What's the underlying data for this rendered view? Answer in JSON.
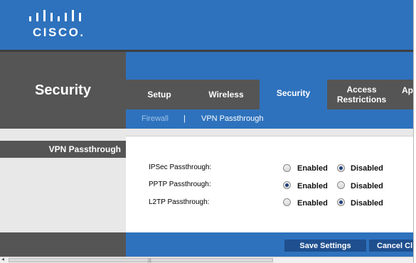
{
  "logo": {
    "text": "CISCO."
  },
  "header": {
    "page_title": "Security"
  },
  "tabs": [
    {
      "label": "Setup",
      "active": false
    },
    {
      "label": "Wireless",
      "active": false
    },
    {
      "label": "Security",
      "active": true
    },
    {
      "label": "Access\nRestrictions",
      "active": false
    },
    {
      "label": "Ap",
      "active": false
    }
  ],
  "subnav": {
    "firewall": "Firewall",
    "separator": "|",
    "vpn": "VPN Passthrough"
  },
  "section": {
    "label": "VPN Passthrough"
  },
  "settings": [
    {
      "label": "IPSec Passthrough:",
      "enabled_label": "Enabled",
      "disabled_label": "Disabled",
      "value": "Disabled"
    },
    {
      "label": "PPTP Passthrough:",
      "enabled_label": "Enabled",
      "disabled_label": "Disabled",
      "value": "Enabled"
    },
    {
      "label": "L2TP Passthrough:",
      "enabled_label": "Enabled",
      "disabled_label": "Disabled",
      "value": "Disabled"
    }
  ],
  "buttons": {
    "save": "Save Settings",
    "cancel": "Cancel Cl"
  },
  "colors": {
    "brand_blue": "#2e72bd",
    "dark_gray": "#555555",
    "button_blue": "#1f4f8f"
  }
}
